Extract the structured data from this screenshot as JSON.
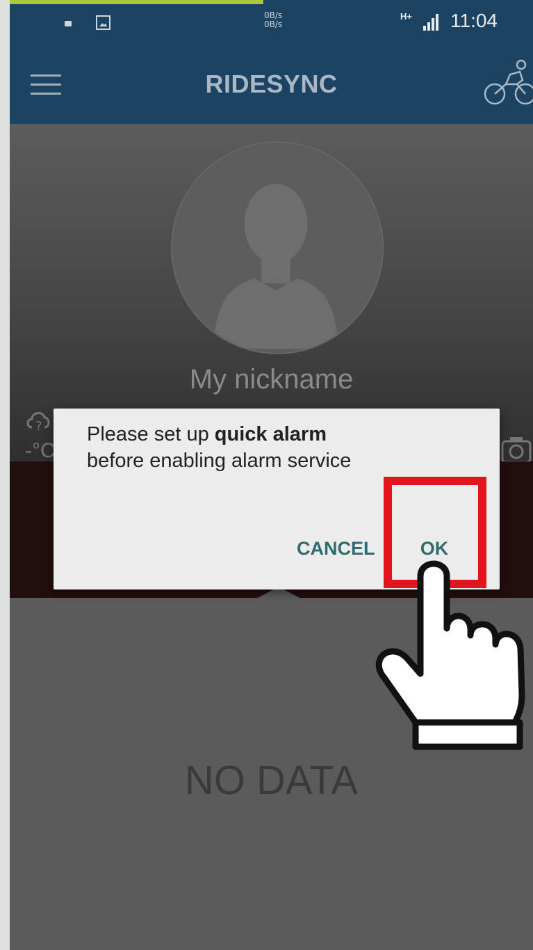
{
  "status_bar": {
    "speed_up": "0B/s",
    "speed_down": "0B/s",
    "network": "H+",
    "time": "11:04"
  },
  "header": {
    "title": "RIDESYNC",
    "menu_icon": "hamburger-menu-icon",
    "right_icon": "bicycle-rider-icon"
  },
  "profile": {
    "nickname": "My nickname",
    "weather_temp": "-°C"
  },
  "main": {
    "empty_text": "NO DATA"
  },
  "dialog": {
    "message_prefix": "Please set up ",
    "message_bold": "quick alarm",
    "message_suffix": "before enabling alarm service",
    "cancel_label": "CANCEL",
    "ok_label": "OK"
  },
  "colors": {
    "header_bg": "#1c4462",
    "highlight": "#e4141e",
    "button_text": "#2f6b70"
  }
}
